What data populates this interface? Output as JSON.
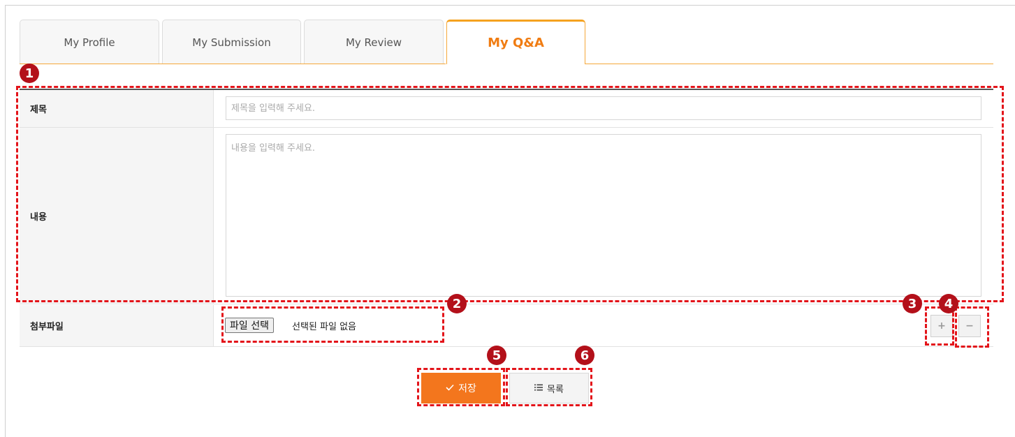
{
  "tabs": [
    {
      "label": "My Profile",
      "active": false
    },
    {
      "label": "My Submission",
      "active": false
    },
    {
      "label": "My Review",
      "active": false
    },
    {
      "label": "My Q&A",
      "active": true
    }
  ],
  "form": {
    "title_label": "제목",
    "title_placeholder": "제목을 입력해 주세요.",
    "content_label": "내용",
    "content_placeholder": "내용을 입력해 주세요.",
    "attachment_label": "첨부파일",
    "file_button_label": "파일 선택",
    "file_status": "선택된 파일 없음",
    "add_icon": "plus-icon",
    "remove_icon": "minus-icon"
  },
  "actions": {
    "save_label": "저장",
    "save_icon": "check-icon",
    "list_label": "목록",
    "list_icon": "list-icon"
  },
  "annotations": [
    "1",
    "2",
    "3",
    "4",
    "5",
    "6"
  ],
  "colors": {
    "accent_orange": "#f3761d",
    "tab_active_text": "#f07c12",
    "annotation_red": "#e3141a",
    "badge_red": "#b3101a"
  }
}
